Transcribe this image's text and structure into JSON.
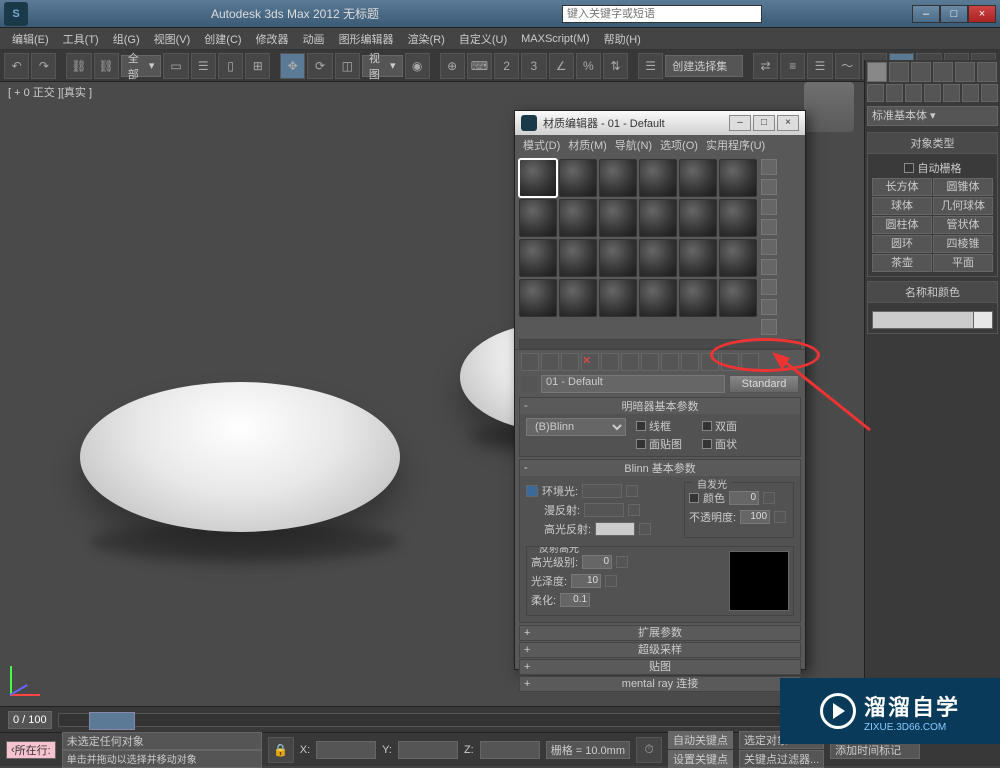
{
  "app": {
    "title": "Autodesk 3ds Max  2012        无标题",
    "search_placeholder": "键入关键字或短语"
  },
  "menu": [
    "编辑(E)",
    "工具(T)",
    "组(G)",
    "视图(V)",
    "创建(C)",
    "修改器",
    "动画",
    "图形编辑器",
    "渲染(R)",
    "自定义(U)",
    "MAXScript(M)",
    "帮助(H)"
  ],
  "toolbar": {
    "scope": "全部",
    "view_label": "视图"
  },
  "viewport": {
    "label": "[ + 0 正交 ][真实 ]"
  },
  "cmd": {
    "category": "标准基本体",
    "rollout_type": "对象类型",
    "auto_grid": "自动栅格",
    "prims": [
      "长方体",
      "圆锥体",
      "球体",
      "几何球体",
      "圆柱体",
      "管状体",
      "圆环",
      "四棱锥",
      "茶壶",
      "平面"
    ],
    "name_color": "名称和颜色"
  },
  "med": {
    "title": "材质编辑器 - 01 - Default",
    "menu": [
      "模式(D)",
      "材质(M)",
      "导航(N)",
      "选项(O)",
      "实用程序(U)"
    ],
    "mat_name": "01 - Default",
    "type_btn": "Standard",
    "shader_roll": "明暗器基本参数",
    "shader": "(B)Blinn",
    "chk_wire": "线框",
    "chk_2side": "双面",
    "chk_facemap": "面贴图",
    "chk_faceted": "面状",
    "blinn_roll": "Blinn 基本参数",
    "ambient": "环境光:",
    "diffuse": "漫反射:",
    "specular": "高光反射:",
    "selfillum": "自发光",
    "color_chk": "颜色",
    "selfillum_val": "0",
    "opacity": "不透明度:",
    "opacity_val": "100",
    "spec_section": "反射高光",
    "spec_level": "高光级别:",
    "spec_level_val": "0",
    "gloss": "光泽度:",
    "gloss_val": "10",
    "soften": "柔化:",
    "soften_val": "0.1",
    "rolls": [
      "扩展参数",
      "超级采样",
      "贴图",
      "mental ray 连接"
    ]
  },
  "timeline": {
    "range": "0 / 100"
  },
  "status": {
    "none_selected": "未选定任何对象",
    "hint1": "单击并拖动以选择并移动对象",
    "loc_label": "所在行:",
    "x": "X:",
    "y": "Y:",
    "z": "Z:",
    "grid": "栅格 = 10.0mm",
    "autokey": "自动关键点",
    "selset": "选定对象",
    "setkey": "设置关键点",
    "keyfilter": "关键点过滤器...",
    "addmarker": "添加时间标记"
  },
  "logo": {
    "big": "溜溜自学",
    "small": "ZIXUE.3D66.COM"
  }
}
